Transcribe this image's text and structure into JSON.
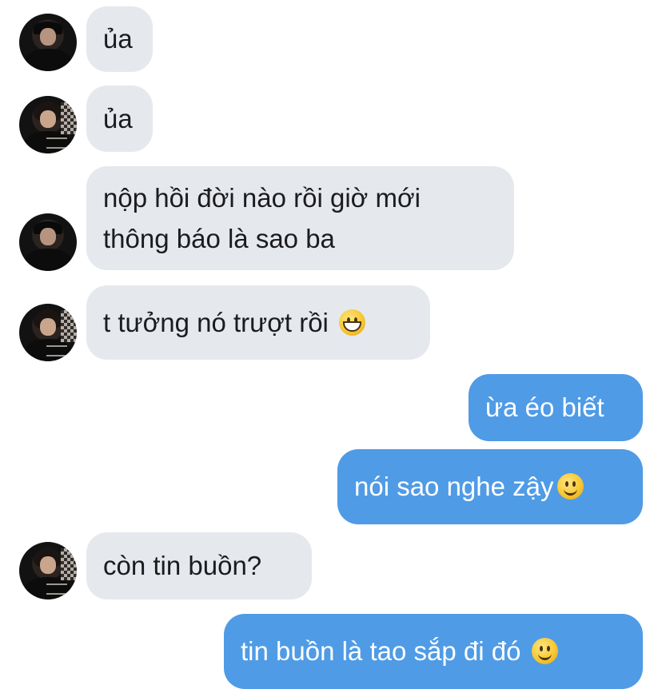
{
  "messages": [
    {
      "direction": "incoming",
      "avatar": "avatar-hat",
      "text": "ủa"
    },
    {
      "direction": "incoming",
      "avatar": "avatar-checker",
      "text": "ủa"
    },
    {
      "direction": "incoming",
      "avatar": "avatar-hat",
      "lines": [
        "nộp hồi đời nào rồi giờ mới",
        "thông báo là sao ba"
      ]
    },
    {
      "direction": "incoming",
      "avatar": "avatar-checker",
      "text": "t tưởng nó trượt rồi",
      "emoji": "grinning-face-emoji"
    },
    {
      "direction": "outgoing",
      "text": "ừa éo biết"
    },
    {
      "direction": "outgoing",
      "text": "nói sao nghe zậy",
      "emoji": "slightly-smiling-face-emoji"
    },
    {
      "direction": "incoming",
      "avatar": "avatar-checker",
      "text": "còn tin buồn?"
    },
    {
      "direction": "outgoing",
      "text": "tin buồn là tao sắp đi đó",
      "emoji": "slightly-smiling-face-emoji"
    }
  ],
  "colors": {
    "incoming_bubble": "#e5e8ed",
    "outgoing_bubble": "#4f9be6",
    "incoming_text": "#1c1c1e",
    "outgoing_text": "#ffffff"
  }
}
